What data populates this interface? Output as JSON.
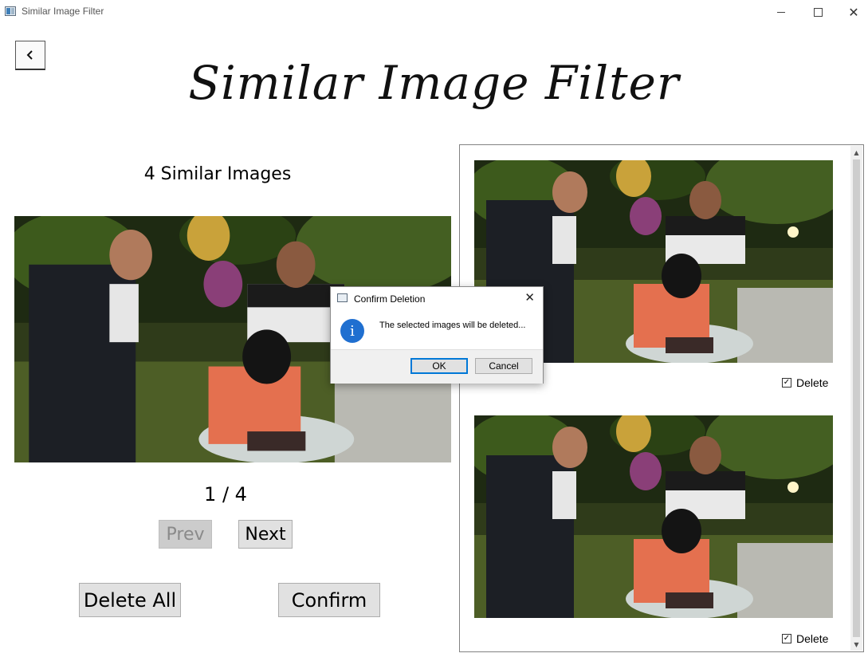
{
  "window": {
    "title": "Similar Image Filter"
  },
  "app": {
    "title": "Similar Image Filter",
    "back_icon": "chevron-left-icon"
  },
  "viewer": {
    "count_label": "4 Similar Images",
    "page_indicator": "1 / 4",
    "prev_label": "Prev",
    "next_label": "Next",
    "prev_disabled": true
  },
  "actions": {
    "delete_all_label": "Delete All",
    "confirm_label": "Confirm"
  },
  "thumbnails": [
    {
      "delete_label": "Delete",
      "checked": true
    },
    {
      "delete_label": "Delete",
      "checked": true
    }
  ],
  "dialog": {
    "title": "Confirm Deletion",
    "message": "The selected images will be deleted...",
    "ok_label": "OK",
    "cancel_label": "Cancel",
    "icon": "info-icon"
  }
}
